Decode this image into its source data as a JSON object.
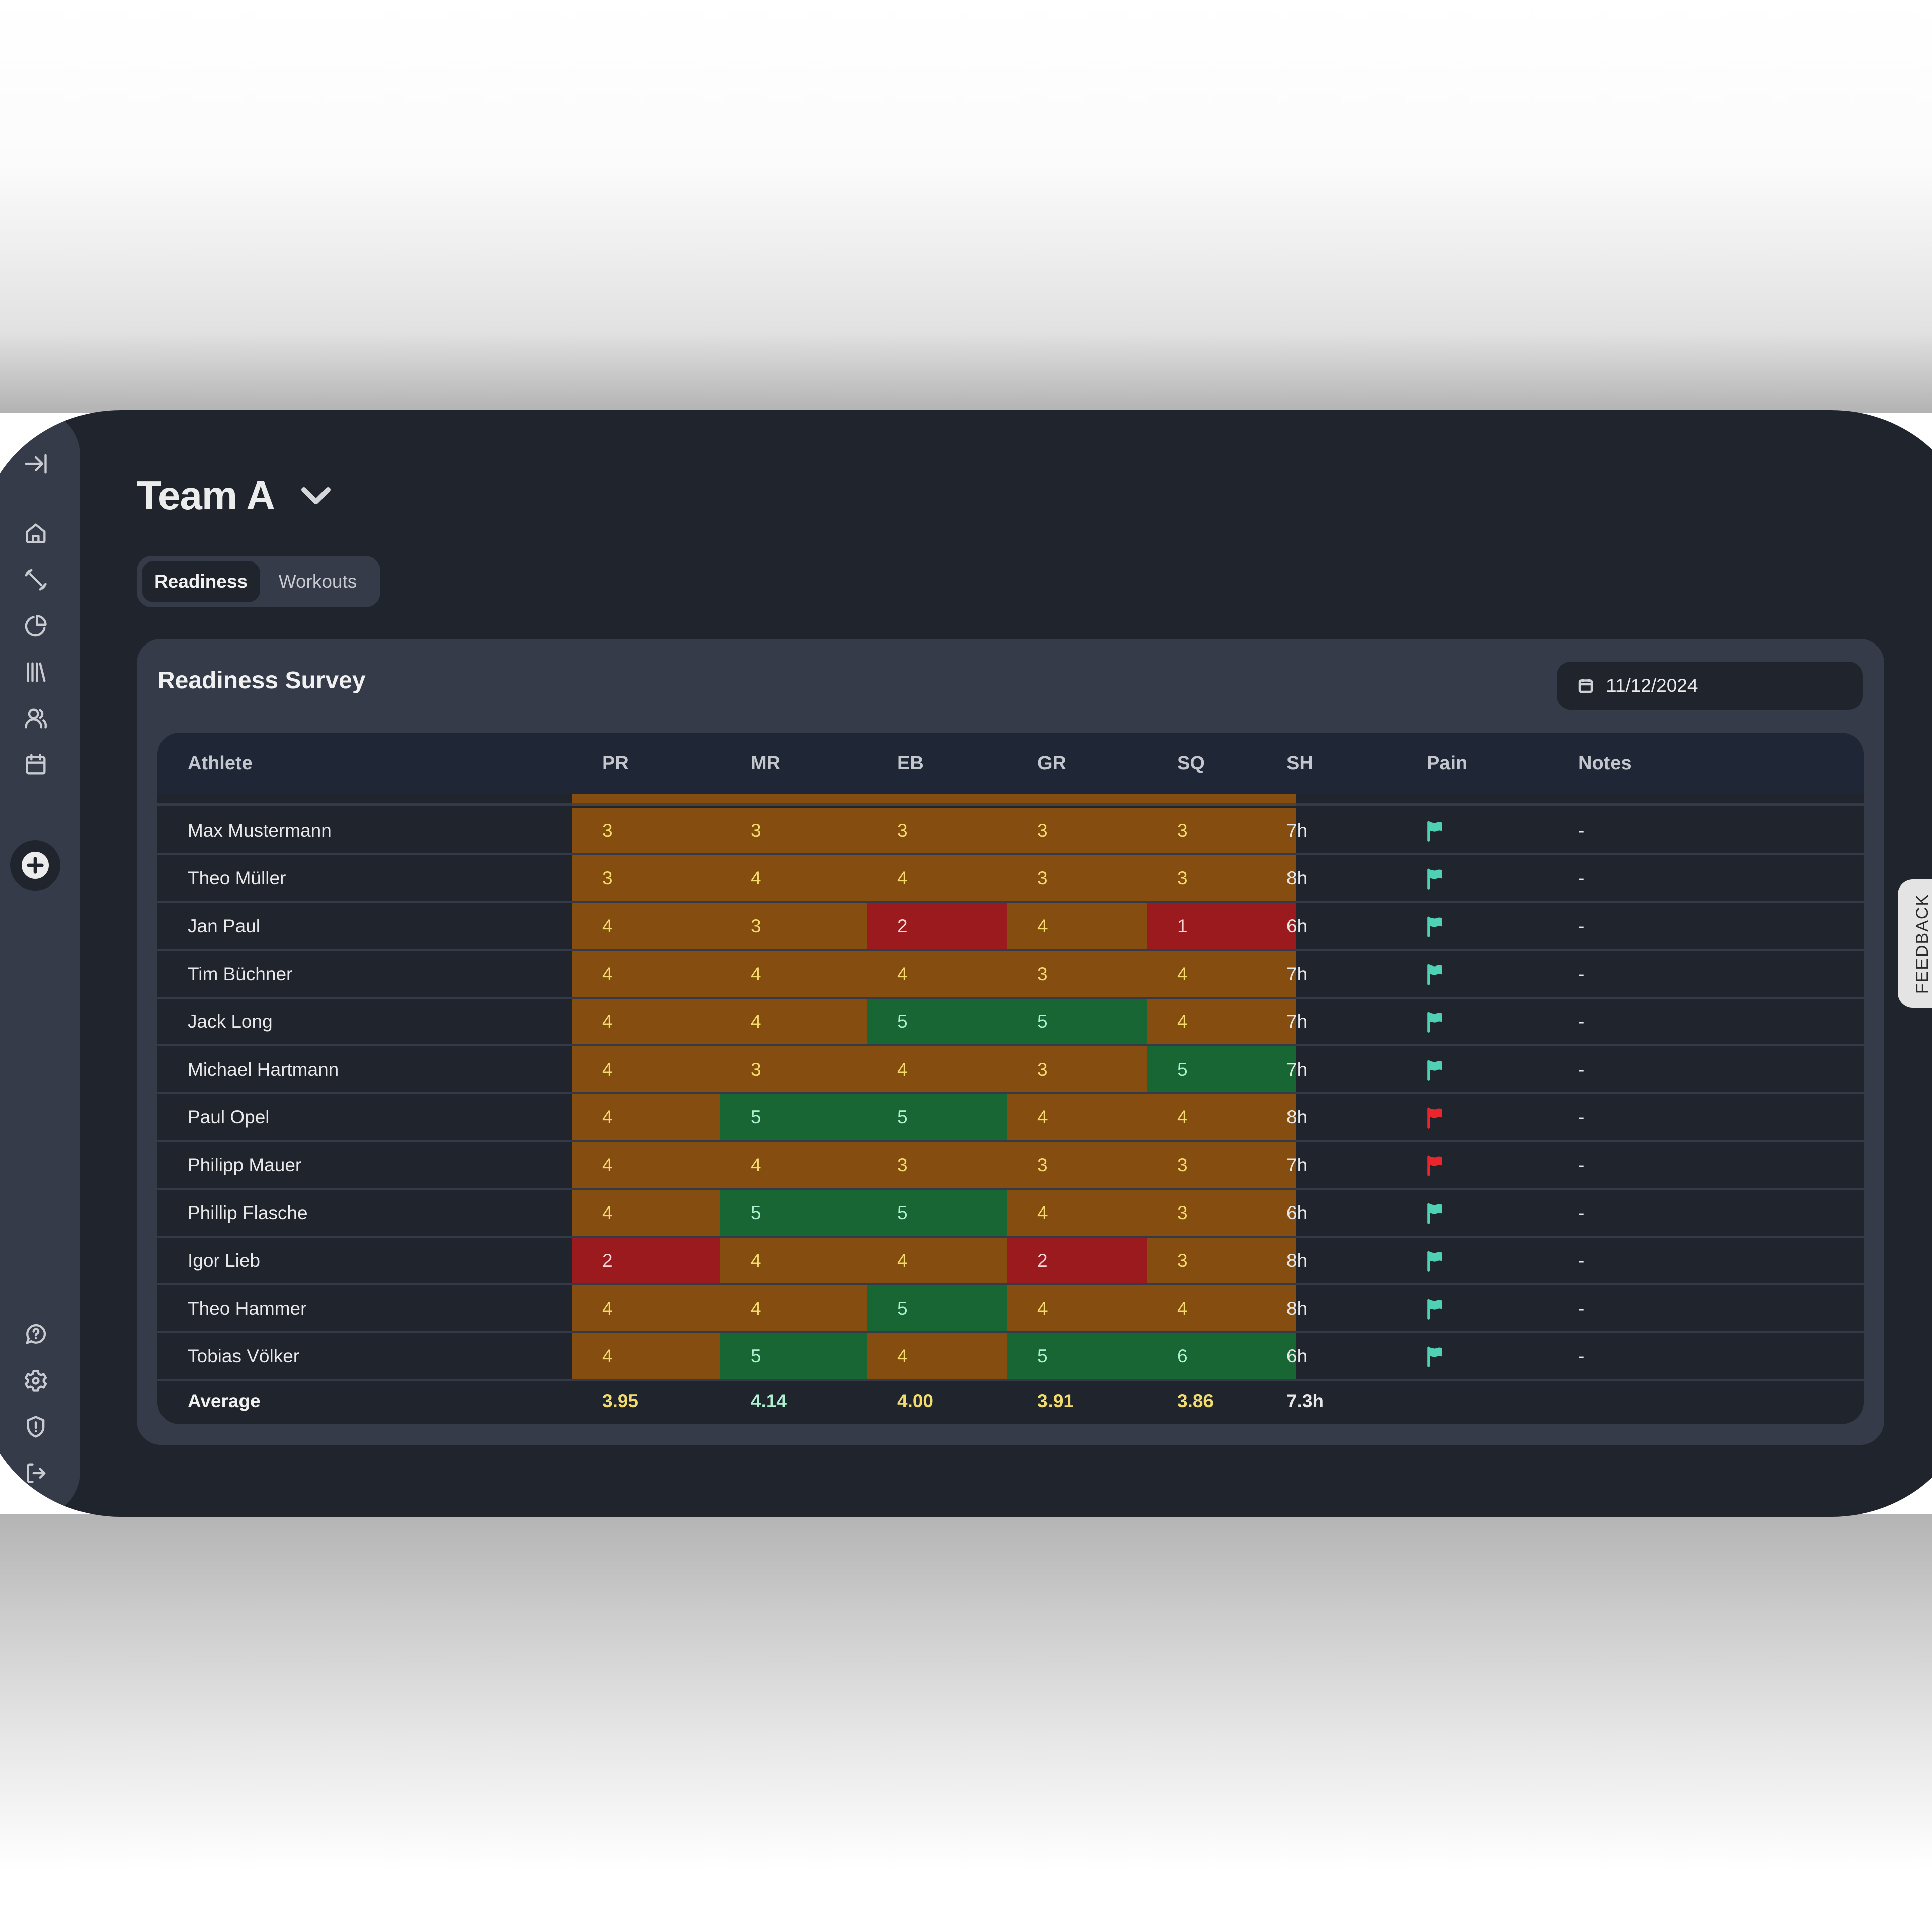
{
  "sidebar": {
    "top_items": [
      {
        "name": "collapse-sidebar",
        "icon": "arrow-right-to-line-icon"
      },
      {
        "name": "home",
        "icon": "home-icon"
      },
      {
        "name": "workouts",
        "icon": "dumbbell-icon"
      },
      {
        "name": "analytics",
        "icon": "pie-chart-icon"
      },
      {
        "name": "library",
        "icon": "library-icon"
      },
      {
        "name": "athletes",
        "icon": "users-icon"
      },
      {
        "name": "calendar",
        "icon": "calendar-icon"
      }
    ],
    "add_button_icon": "plus-circle-icon",
    "bottom_items": [
      {
        "name": "help",
        "icon": "help-bubble-icon"
      },
      {
        "name": "settings",
        "icon": "gear-icon"
      },
      {
        "name": "privacy",
        "icon": "shield-alert-icon"
      },
      {
        "name": "logout",
        "icon": "logout-icon"
      }
    ]
  },
  "header": {
    "team_name": "Team A",
    "team_dropdown_icon": "chevron-down-icon"
  },
  "tabs": [
    {
      "label": "Readiness",
      "active": true
    },
    {
      "label": "Workouts",
      "active": false
    }
  ],
  "survey": {
    "title": "Readiness Survey",
    "date_icon": "calendar-icon",
    "date_value": "11/12/2024",
    "columns": [
      "Athlete",
      "PR",
      "MR",
      "EB",
      "GR",
      "SQ",
      "SH",
      "Pain",
      "Notes"
    ],
    "rows": [
      {
        "athlete": "Max Mustermann",
        "scores": [
          3,
          3,
          3,
          3,
          3
        ],
        "sh": "7h",
        "pain": "green",
        "notes": "-"
      },
      {
        "athlete": "Theo Müller",
        "scores": [
          3,
          4,
          4,
          3,
          3
        ],
        "sh": "8h",
        "pain": "green",
        "notes": "-"
      },
      {
        "athlete": "Jan Paul",
        "scores": [
          4,
          3,
          2,
          4,
          1
        ],
        "sh": "6h",
        "pain": "green",
        "notes": "-"
      },
      {
        "athlete": "Tim Büchner",
        "scores": [
          4,
          4,
          4,
          3,
          4
        ],
        "sh": "7h",
        "pain": "green",
        "notes": "-"
      },
      {
        "athlete": "Jack Long",
        "scores": [
          4,
          4,
          5,
          5,
          4
        ],
        "sh": "7h",
        "pain": "green",
        "notes": "-"
      },
      {
        "athlete": "Michael Hartmann",
        "scores": [
          4,
          3,
          4,
          3,
          5
        ],
        "sh": "7h",
        "pain": "green",
        "notes": "-"
      },
      {
        "athlete": "Paul Opel",
        "scores": [
          4,
          5,
          5,
          4,
          4
        ],
        "sh": "8h",
        "pain": "red",
        "notes": "-"
      },
      {
        "athlete": "Philipp Mauer",
        "scores": [
          4,
          4,
          3,
          3,
          3
        ],
        "sh": "7h",
        "pain": "red",
        "notes": "-"
      },
      {
        "athlete": "Phillip Flasche",
        "scores": [
          4,
          5,
          5,
          4,
          3
        ],
        "sh": "6h",
        "pain": "green",
        "notes": "-"
      },
      {
        "athlete": "Igor Lieb",
        "scores": [
          2,
          4,
          4,
          2,
          3
        ],
        "sh": "8h",
        "pain": "green",
        "notes": "-"
      },
      {
        "athlete": "Theo Hammer",
        "scores": [
          4,
          4,
          5,
          4,
          4
        ],
        "sh": "8h",
        "pain": "green",
        "notes": "-"
      },
      {
        "athlete": "Tobias Völker",
        "scores": [
          4,
          5,
          4,
          5,
          6
        ],
        "sh": "6h",
        "pain": "green",
        "notes": "-"
      }
    ],
    "average": {
      "label": "Average",
      "values": [
        {
          "value": "3.95",
          "tone": "yellow"
        },
        {
          "value": "4.14",
          "tone": "green"
        },
        {
          "value": "4.00",
          "tone": "yellow"
        },
        {
          "value": "3.91",
          "tone": "yellow"
        },
        {
          "value": "3.86",
          "tone": "yellow"
        }
      ],
      "sh": "7.3h"
    }
  },
  "colors": {
    "score_low": "#9a1a1e",
    "score_mid": "#854d10",
    "score_high": "#176634",
    "flag_ok": "#4fd1b5",
    "flag_pain": "#e8262b",
    "avg_yellow": "#f4dc6c",
    "avg_green": "#aef0cf"
  },
  "feedback_tab": {
    "label": "FEEDBACK"
  }
}
